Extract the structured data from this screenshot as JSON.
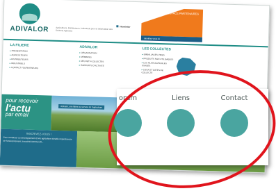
{
  "site": {
    "brand": "ADIVALOR",
    "tagline": "Agriculteurs, Distributeurs, Industriels pour la Valorisation des Déchets Agricoles",
    "newsletter_label": "Newsletter",
    "partner_title": "ESPACE PARTENAIRES",
    "partner_bar": "Identifiez-vous ici",
    "columns": [
      {
        "title": "LA FILIERE",
        "items": [
          "PRESENTATION",
          "AGRICULTEURS",
          "DISTRIBUTEURS",
          "INDUSTRIELS",
          "CONTACT FOURNISSEURS"
        ]
      },
      {
        "title": "ADIVALOR",
        "items": [
          "ORGANISATION",
          "MEMBRES",
          "DÉCHETS COLLECTÉS",
          "RAPPORTS D'ACTIVITÉ"
        ]
      },
      {
        "title": "LES COLLECTES",
        "items": [
          "EMBALLAGES VIDES",
          "PRODUITS NON UTILISABLES",
          "LES FILMS AGRICOLES USAGÉS",
          "LIEUX ET DATES DE COLLECTE"
        ]
      }
    ],
    "actu_line1": "pour recevoir",
    "actu_big": "l'actu",
    "actu_line3": "par email",
    "photo_banner": "Adivalor, une filière au service de l'agriculture",
    "bottom_heading": "INSCRIVEZ-VOUS !",
    "bottom_text": "Pour contribuer au développement d'une agriculture durable respectueuse de l'environnement, la société ADIVALOR..."
  },
  "zoom": {
    "items": [
      {
        "label": "orum"
      },
      {
        "label": "Liens"
      },
      {
        "label": "Contact"
      }
    ]
  },
  "colors": {
    "teal": "#1f8d86",
    "orange": "#f07a1c",
    "highlight_red": "#e0141c",
    "circle": "#4aa5a0"
  }
}
